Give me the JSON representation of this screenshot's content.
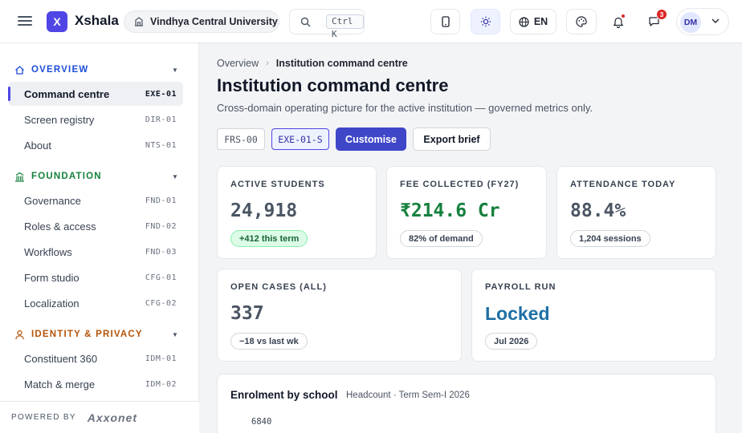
{
  "app": {
    "brand": "Xshala",
    "logo_letter": "X",
    "institution": "Vindhya Central University",
    "search_shortcut": "Ctrl K",
    "language": "EN",
    "notifications_count": "3",
    "user_initials": "DM",
    "accent": "#4f46e5"
  },
  "sidebar": {
    "sections": [
      {
        "title": "OVERVIEW",
        "icon": "home-icon",
        "color": "#1d4ed8",
        "items": [
          {
            "label": "Command centre",
            "code": "EXE-01",
            "active": true
          },
          {
            "label": "Screen registry",
            "code": "DIR-01"
          },
          {
            "label": "About",
            "code": "NTS-01"
          }
        ]
      },
      {
        "title": "FOUNDATION",
        "icon": "building-icon",
        "color": "#15803d",
        "items": [
          {
            "label": "Governance",
            "code": "FND-01"
          },
          {
            "label": "Roles & access",
            "code": "FND-02"
          },
          {
            "label": "Workflows",
            "code": "FND-03"
          },
          {
            "label": "Form studio",
            "code": "CFG-01"
          },
          {
            "label": "Localization",
            "code": "CFG-02"
          }
        ]
      },
      {
        "title": "IDENTITY & PRIVACY",
        "icon": "person-icon",
        "color": "#b45309",
        "items": [
          {
            "label": "Constituent 360",
            "code": "IDM-01"
          },
          {
            "label": "Match & merge",
            "code": "IDM-02"
          }
        ]
      }
    ],
    "powered_by": "POWERED BY",
    "powered_brand": "Axxonet"
  },
  "main": {
    "breadcrumb": [
      "Overview",
      "Institution command centre"
    ],
    "title": "Institution command centre",
    "subtitle": "Cross-domain operating picture for the active institution — governed metrics only.",
    "chips": [
      "FRS-00",
      "EXE-01-S"
    ],
    "customise_label": "Customise",
    "export_label": "Export brief",
    "kpis": [
      {
        "label": "ACTIVE STUDENTS",
        "value": "24,918",
        "note": "+412 this term",
        "note_style": "green",
        "color": "#4b5563"
      },
      {
        "label": "FEE COLLECTED (FY27)",
        "value": "₹214.6 Cr",
        "note": "82% of demand",
        "color": "#15803d"
      },
      {
        "label": "ATTENDANCE TODAY",
        "value": "88.4%",
        "note": "1,204 sessions",
        "color": "#4b5563"
      },
      {
        "label": "OPEN CASES (ALL)",
        "value": "337",
        "note": "−18 vs last wk",
        "color": "#4b5563"
      },
      {
        "label": "PAYROLL RUN",
        "value": "Locked",
        "note": "Jul 2026",
        "color": "#1d6fa5"
      }
    ],
    "enrolment": {
      "title": "Enrolment by school",
      "subtitle": "Headcount · Term Sem-I 2026",
      "first_bar_value": "6840"
    }
  }
}
